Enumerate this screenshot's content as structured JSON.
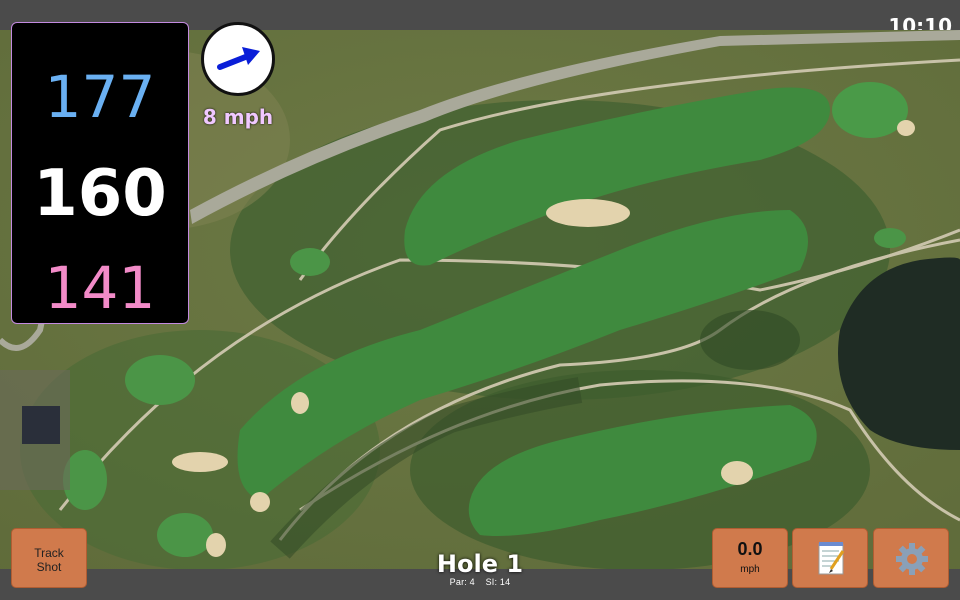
{
  "status": {
    "clock": "10:10"
  },
  "distances": {
    "back": "177",
    "middle": "160",
    "front": "141"
  },
  "wind": {
    "speed_label": "8 mph",
    "icon": "arrow-icon"
  },
  "track_button": {
    "line1": "Track",
    "line2": "Shot"
  },
  "speed_button": {
    "value": "0.0",
    "unit": "mph"
  },
  "hole": {
    "title": "Hole 1",
    "par": "Par: 4",
    "si": "SI: 14"
  },
  "icons": {
    "notes": "notepad-icon",
    "settings": "gear-icon"
  },
  "colors": {
    "button": "#d07a4c",
    "back_distance": "#6ab0f2",
    "front_distance": "#f28bc8",
    "wind_label": "#f0c8ff"
  }
}
